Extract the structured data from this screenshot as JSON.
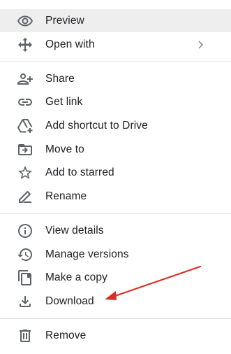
{
  "menu": {
    "items": [
      {
        "label": "Preview",
        "icon": "eye-icon"
      },
      {
        "label": "Open with",
        "icon": "move-arrows-icon"
      },
      {
        "label": "Share",
        "icon": "person-add-icon"
      },
      {
        "label": "Get link",
        "icon": "link-icon"
      },
      {
        "label": "Add shortcut to Drive",
        "icon": "add-to-drive-icon"
      },
      {
        "label": "Move to",
        "icon": "move-to-folder-icon"
      },
      {
        "label": "Add to starred",
        "icon": "star-outline-icon"
      },
      {
        "label": "Rename",
        "icon": "pencil-icon"
      },
      {
        "label": "View details",
        "icon": "info-icon"
      },
      {
        "label": "Manage versions",
        "icon": "history-icon"
      },
      {
        "label": "Make a copy",
        "icon": "copy-icon"
      },
      {
        "label": "Download",
        "icon": "download-icon"
      },
      {
        "label": "Remove",
        "icon": "trash-icon"
      }
    ]
  },
  "colors": {
    "highlight": "#eeeeee",
    "icon": "#5f6368",
    "text": "#202124",
    "divider": "#e0e0e0",
    "annotation_arrow": "#d93025"
  }
}
